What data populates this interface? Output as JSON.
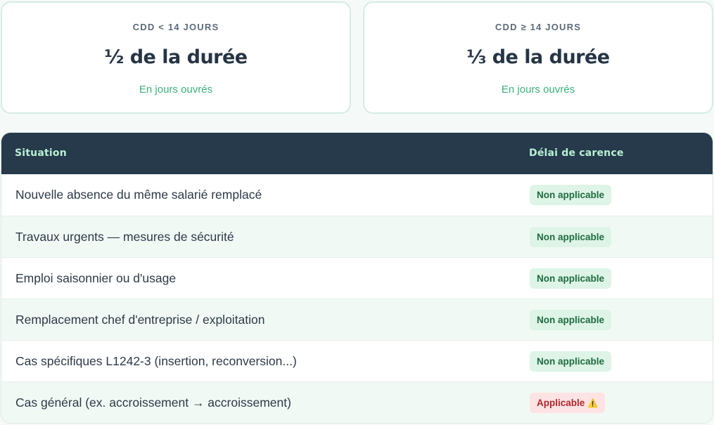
{
  "cards": [
    {
      "kicker": "CDD < 14 JOURS",
      "value": "½ de la durée",
      "sub": "En jours ouvrés"
    },
    {
      "kicker": "CDD ≥ 14 JOURS",
      "value": "⅓ de la durée",
      "sub": "En jours ouvrés"
    }
  ],
  "table": {
    "headers": {
      "situation": "Situation",
      "delay": "Délai de carence"
    },
    "rows": [
      {
        "situation": "Nouvelle absence du même salarié remplacé",
        "status": "Non applicable",
        "kind": "ok"
      },
      {
        "situation": "Travaux urgents — mesures de sécurité",
        "status": "Non applicable",
        "kind": "ok"
      },
      {
        "situation": "Emploi saisonnier ou d'usage",
        "status": "Non applicable",
        "kind": "ok"
      },
      {
        "situation": "Remplacement chef d'entreprise / exploitation",
        "status": "Non applicable",
        "kind": "ok"
      },
      {
        "situation": "Cas spécifiques L1242-3 (insertion, reconversion...)",
        "status": "Non applicable",
        "kind": "ok"
      },
      {
        "situation": "Cas général (ex. accroissement → accroissement)",
        "status": "Applicable",
        "kind": "warn",
        "icon": "⚠️"
      }
    ]
  },
  "colors": {
    "accent": "#3bb27a",
    "header_bg": "#263a4b",
    "header_text": "#b8f0d4",
    "ok_bg": "#ddf4e6",
    "warn_bg": "#fde3e3"
  }
}
